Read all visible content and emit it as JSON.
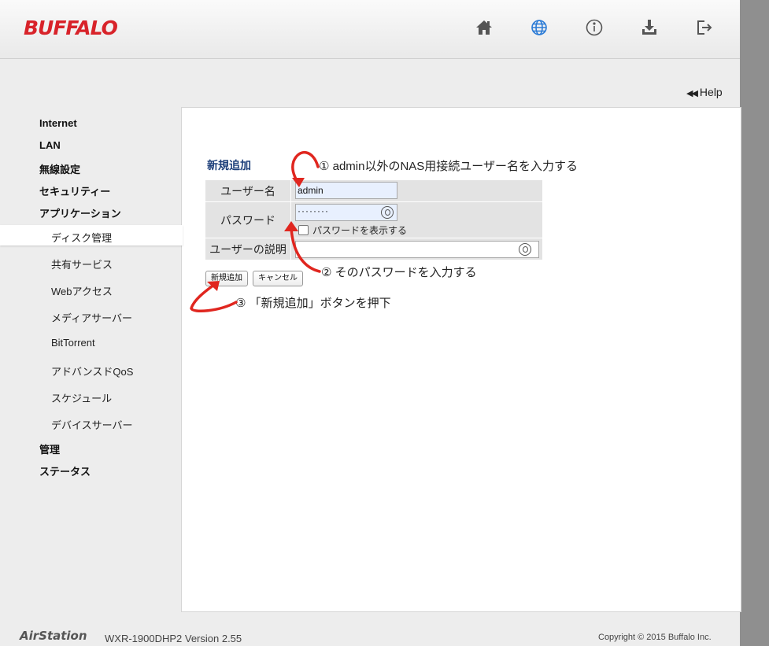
{
  "header": {
    "brand": "BUFFALO",
    "icons": [
      "home-icon",
      "globe-icon",
      "info-icon",
      "download-icon",
      "logout-icon"
    ],
    "accent_color": "#d8232a",
    "active_icon_color": "#2b7bd6"
  },
  "help": {
    "label": "Help"
  },
  "sidebar": {
    "items": [
      {
        "label": "Internet"
      },
      {
        "label": "LAN"
      },
      {
        "label": "無線設定"
      },
      {
        "label": "セキュリティー"
      },
      {
        "label": "アプリケーション"
      }
    ],
    "sub_items": [
      {
        "label": "ディスク管理",
        "active": true
      },
      {
        "label": "共有サービス"
      },
      {
        "label": "Webアクセス"
      },
      {
        "label": "メディアサーバー"
      },
      {
        "label": "BitTorrent"
      },
      {
        "label": "アドバンスドQoS"
      },
      {
        "label": "スケジュール"
      },
      {
        "label": "デバイスサーバー"
      }
    ],
    "bottom_items": [
      {
        "label": "管理"
      },
      {
        "label": "ステータス"
      }
    ]
  },
  "form": {
    "title": "新規追加",
    "username_label": "ユーザー名",
    "username_value": "admin",
    "password_label": "パスワード",
    "password_value": "········",
    "show_password_label": "パスワードを表示する",
    "description_label": "ユーザーの説明",
    "description_value": "",
    "add_button": "新規追加",
    "cancel_button": "キャンセル"
  },
  "annotations": {
    "step1": "① admin以外のNAS用接続ユーザー名を入力する",
    "step2": "② そのパスワードを入力する",
    "step3": "③ 「新規追加」ボタンを押下",
    "arrow_color": "#e0261f"
  },
  "footer": {
    "product": "AirStation",
    "model": "WXR-1900DHP2   Version 2.55",
    "copyright": "Copyright © 2015 Buffalo Inc."
  }
}
